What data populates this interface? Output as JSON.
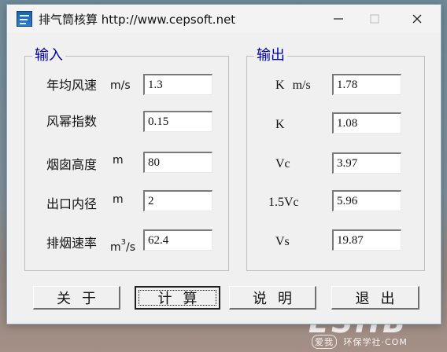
{
  "window": {
    "title": "排气筒核算  http://www.cepsoft.net",
    "controls": {
      "minimize": "—",
      "maximize": "□",
      "close": "✕"
    }
  },
  "input_group": {
    "title": "输入",
    "rows": [
      {
        "label": "年均风速",
        "unit": "m/s",
        "value": "1.3"
      },
      {
        "label": "风幂指数",
        "unit": "",
        "value": "0.15"
      },
      {
        "label": "烟囱高度",
        "unit": "m",
        "value": "80"
      },
      {
        "label": "出口内径",
        "unit": "m",
        "value": "2"
      },
      {
        "label": "排烟速率",
        "unit": "m3/s",
        "value": "62.4"
      }
    ]
  },
  "output_group": {
    "title": "输出",
    "rows": [
      {
        "label": "K",
        "unit": "m/s",
        "value": "1.78"
      },
      {
        "label": "K",
        "unit": "",
        "value": "1.08"
      },
      {
        "label": "Vc",
        "unit": "",
        "value": "3.97"
      },
      {
        "label": "1.5Vc",
        "unit": "",
        "value": "5.96"
      },
      {
        "label": "Vs",
        "unit": "",
        "value": "19.87"
      }
    ]
  },
  "buttons": {
    "about": "关于",
    "calculate": "计算",
    "help": "说明",
    "exit": "退出"
  },
  "watermark": {
    "brand": "ESHB",
    "site": "环保学社·COM",
    "badge": "爱我"
  },
  "icons": {
    "app": "app-icon",
    "minimize": "minimize-icon",
    "maximize": "maximize-icon",
    "close": "close-icon"
  }
}
